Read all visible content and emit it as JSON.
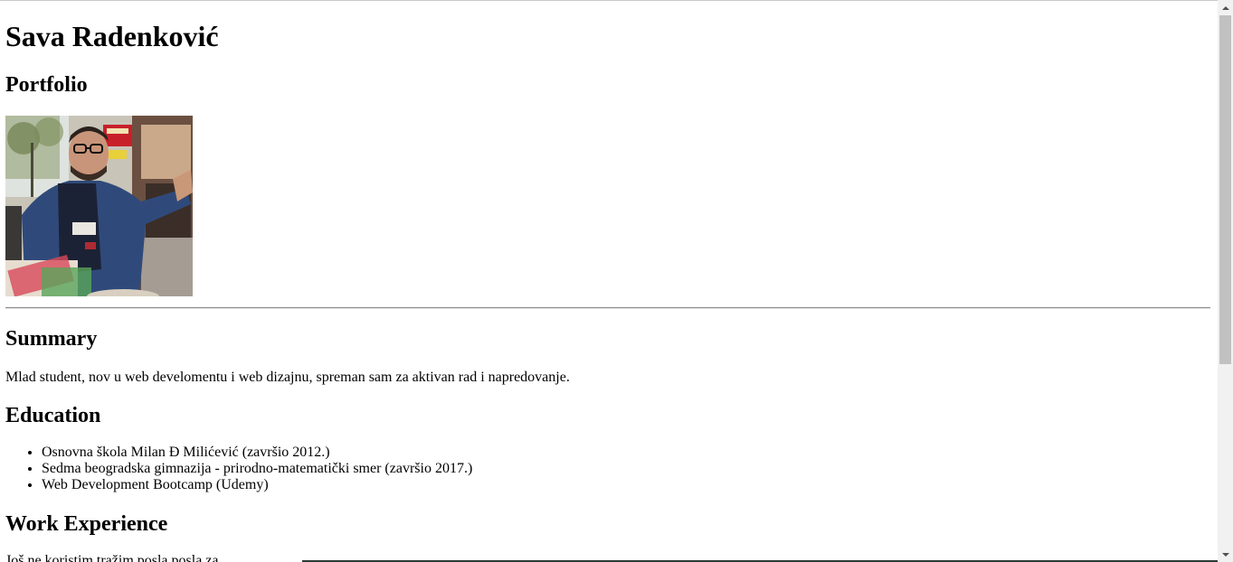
{
  "header": {
    "name": "Sava Radenković",
    "subtitle": "Portfolio"
  },
  "photo": {
    "icon": "profile-photo"
  },
  "summary": {
    "heading": "Summary",
    "text": "Mlad student, nov u web develomentu i web dizajnu, spreman sam za aktivan rad i napredovanje."
  },
  "education": {
    "heading": "Education",
    "items": [
      "Osnovna škola Milan Đ Milićević (završio 2012.)",
      "Sedma beogradska gimnazija - prirodno-matematički smer (završio 2017.)",
      "Web Development Bootcamp (Udemy)"
    ]
  },
  "work": {
    "heading": "Work Experience",
    "text": "Još ne koristim tražim posla posla za"
  },
  "colors": {
    "background": "#ffffff",
    "text": "#000000",
    "scrollbar_track": "#f1f1f1",
    "scrollbar_thumb": "#c1c1c1"
  }
}
